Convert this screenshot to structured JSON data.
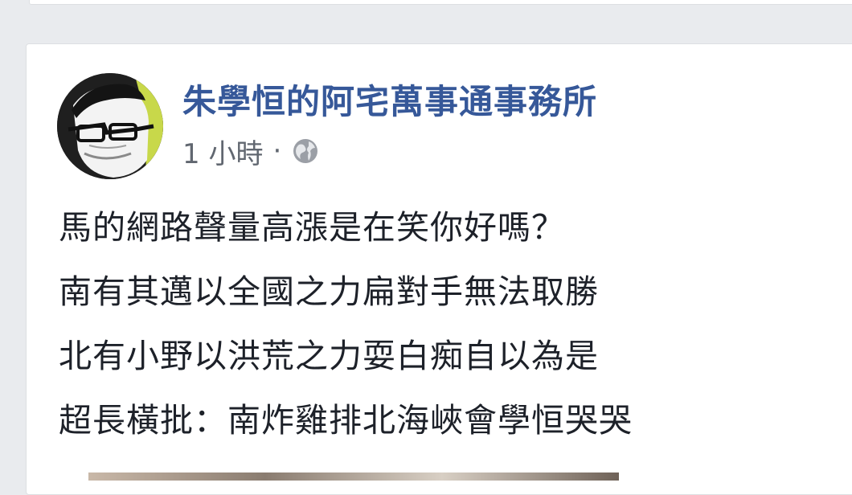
{
  "post": {
    "page_name": "朱學恒的阿宅萬事通事務所",
    "timestamp": "1 小時",
    "separator": "·",
    "privacy_icon": "globe-icon",
    "lines": [
      "馬的網路聲量高漲是在笑你好嗎？",
      "南有其邁以全國之力扁對手無法取勝",
      "北有小野以洪荒之力耍白痴自以為是",
      "超長橫批：南炸雞排北海峽會學恒哭哭"
    ]
  },
  "colors": {
    "background": "#e9ebee",
    "card": "#ffffff",
    "link": "#365899",
    "meta": "#616770",
    "text": "#1d2129"
  }
}
